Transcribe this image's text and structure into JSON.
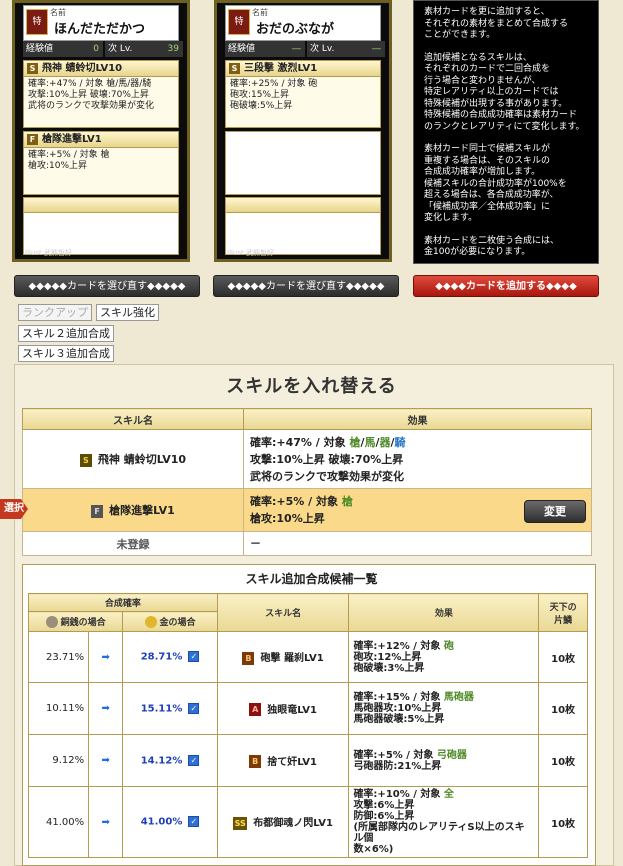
{
  "cards": [
    {
      "name_label": "名前",
      "name": "ほんだただかつ",
      "crest": "特",
      "xp_label": "経験値",
      "xp": "0",
      "next_label": "次 Lv.",
      "next": "39",
      "skill1": {
        "rank": "S",
        "name": "飛神 蜻蛉切LV10",
        "lines": [
          "確率:+47% / 対象 槍/馬/器/騎",
          "攻撃:10%上昇 破壊:70%上昇",
          "武将のランクで攻撃効果が変化"
        ]
      },
      "skill2": {
        "rank": "F",
        "name": "槍隊進撃LV1",
        "lines": [
          "確率:+5% / 対象 槍",
          "槍攻:10%上昇"
        ]
      },
      "illust": "Illust 武熊哲好"
    },
    {
      "name_label": "名前",
      "name": "おだのぶなが",
      "crest": "特",
      "xp_label": "経験値",
      "xp": "―",
      "next_label": "次 Lv.",
      "next": "―",
      "skill1": {
        "rank": "S",
        "name": "三段撃 激烈LV1",
        "lines": [
          "確率:+25% / 対象 砲",
          "砲攻:15%上昇",
          "砲破壊:5%上昇"
        ]
      },
      "illust": "Illust 武熊哲好"
    }
  ],
  "info_text": [
    "素材カードを更に追加すると、\nそれぞれの素材をまとめて合成する\nことができます。",
    "追加候補となるスキルは、\nそれぞれのカードで二回合成を\n行う場合と変わりませんが、\n特定レアリティ以上のカードでは\n特殊候補が出現する事があります。\n特殊候補の合成成功確率は素材カード\nのランクとレアリティにて変化します。",
    "素材カード同士で候補スキルが\n重複する場合は、そのスキルの\n合成成功確率が増加します。\n候補スキルの合計成功率が100%を\n超える場合は、各合成成功率が、\n「候補成功率／全体成功率」に\n変化します。",
    "素材カードを二枚使う合成には、\n金100が必要になります。"
  ],
  "buttons": {
    "reselect1": "◆◆◆◆◆カードを選び直す◆◆◆◆◆",
    "reselect2": "◆◆◆◆◆カードを選び直す◆◆◆◆◆",
    "add_card": "◆◆◆◆カードを追加する◆◆◆◆",
    "rank_up": "ランクアップ",
    "skill_up": "スキル強化",
    "skill2_add": "スキル２追加合成",
    "skill3_add": "スキル３追加合成",
    "change": "変更"
  },
  "swap": {
    "title": "スキルを入れ替える",
    "col_name": "スキル名",
    "col_effect": "効果",
    "tag": "選択中",
    "rows": [
      {
        "rank": "S",
        "name": "飛神 蜻蛉切LV10",
        "effect": [
          "確率:+47% / 対象 ",
          "攻撃:10%上昇 破壊:70%上昇",
          "武将のランクで攻撃効果が変化"
        ],
        "targets": [
          "槍",
          "/",
          "馬",
          "/",
          "器",
          "/",
          "騎"
        ]
      },
      {
        "rank": "F",
        "name": "槍隊進撃LV1",
        "effect": [
          "確率:+5% / 対象 ",
          "槍攻:10%上昇"
        ],
        "targets": [
          "槍"
        ]
      },
      {
        "name": "未登録",
        "effect": [
          "－"
        ]
      }
    ]
  },
  "candidates": {
    "title": "スキル追加合成候補一覧",
    "h_rate": "合成確率",
    "h_silver": "銅銭の場合",
    "h_gold": "金の場合",
    "h_name": "スキル名",
    "h_effect": "効果",
    "h_count": "天下の\n片鱗",
    "rows": [
      {
        "silver": "23.71%",
        "gold": "28.71%",
        "rank": "B",
        "name": "砲撃 羅刹LV1",
        "effect": [
          "確率:+12% / 対象 ",
          "砲攻:12%上昇",
          "砲破壊:3%上昇"
        ],
        "target": "砲",
        "count": "10枚"
      },
      {
        "silver": "10.11%",
        "gold": "15.11%",
        "rank": "A",
        "name": "独眼竜LV1",
        "effect": [
          "確率:+15% / 対象 ",
          "馬砲器攻:10%上昇",
          "馬砲器破壊:5%上昇"
        ],
        "target": "馬砲器",
        "count": "10枚"
      },
      {
        "silver": "9.12%",
        "gold": "14.12%",
        "rank": "B",
        "name": "捨て奸LV1",
        "effect": [
          "確率:+5% / 対象 ",
          "弓砲器防:21%上昇"
        ],
        "target": "弓砲器",
        "count": "10枚"
      },
      {
        "silver": "41.00%",
        "gold": "41.00%",
        "rank": "SS",
        "name": "布都御魂ノ閃LV1",
        "effect": [
          "確率:+10% / 対象 ",
          "攻撃:6%上昇",
          "防御:6%上昇",
          "(所属部隊内のレアリティS以上のスキル個",
          "数×6%)"
        ],
        "target": "全",
        "count": "10枚"
      }
    ]
  },
  "colors": {
    "accent_red": "#c3381f",
    "gold_text": "#1e3fb8",
    "target_green": "#4f8b28"
  }
}
